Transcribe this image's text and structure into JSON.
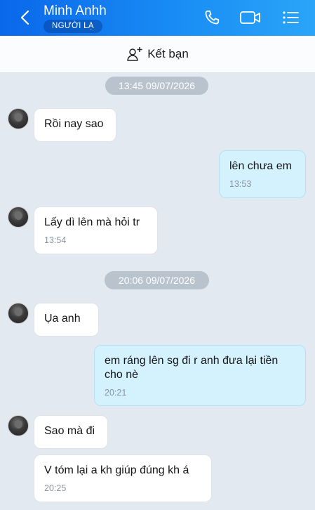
{
  "header": {
    "contact_name": "Minh Anhh",
    "badge": "NGƯỜI LẠ"
  },
  "friend_bar": {
    "label": "Kết bạn"
  },
  "dates": [
    "13:45 09/07/2026",
    "20:06 09/07/2026"
  ],
  "messages": [
    {
      "text": "Rồi nay sao",
      "time": ""
    },
    {
      "text": "lên chưa em",
      "time": "13:53"
    },
    {
      "text": "Lấy dì lên mà hỏi tr",
      "time": "13:54"
    },
    {
      "text": "Ụa anh",
      "time": ""
    },
    {
      "text": "em ráng lên sg đi r anh đưa lại tiền cho nè",
      "time": "20:21"
    },
    {
      "text": "Sao mà đi",
      "time": ""
    },
    {
      "text": "V tóm lại a kh giúp đúng kh á",
      "time": "20:25"
    }
  ],
  "colors": {
    "header_start": "#0a67ea",
    "header_end": "#2aa5f8",
    "background": "#e2e9f1",
    "outgoing_bubble": "#d4f1fe",
    "incoming_bubble": "#ffffff"
  },
  "icons": [
    "back-icon",
    "phone-icon",
    "video-call-icon",
    "menu-list-icon",
    "add-friend-icon"
  ]
}
